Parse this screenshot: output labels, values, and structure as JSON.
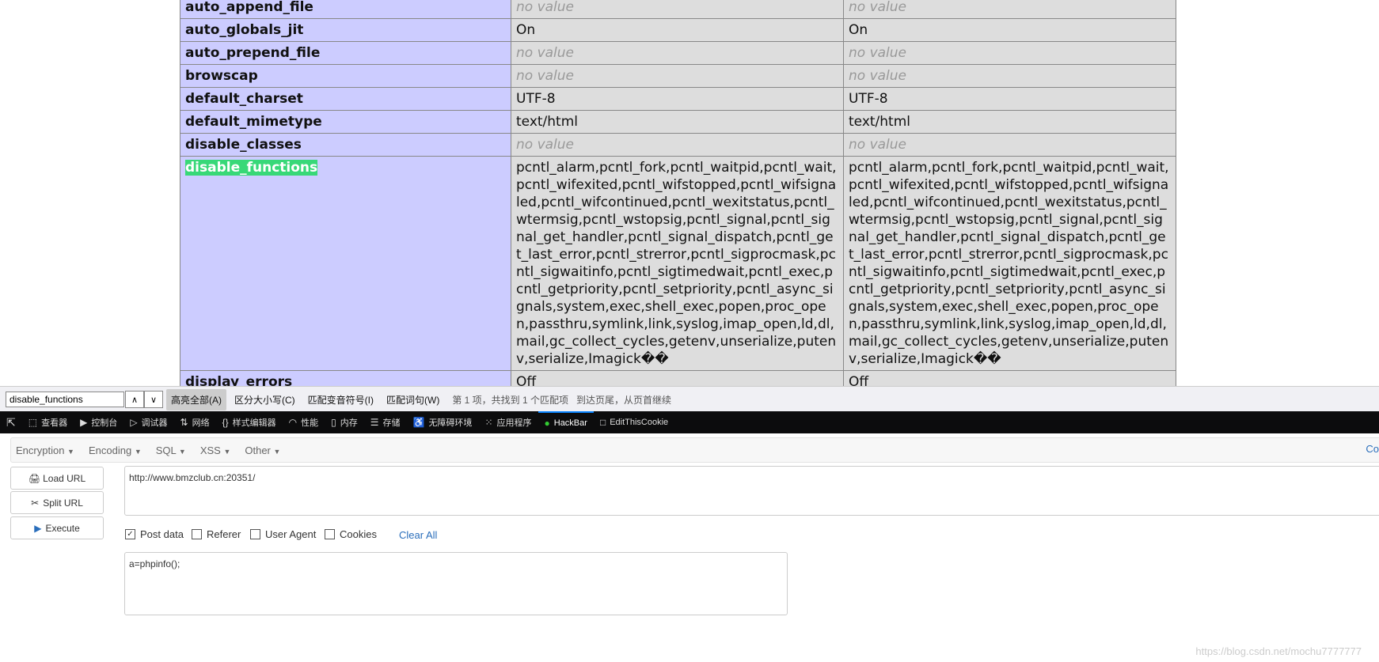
{
  "phpinfo": {
    "rows": [
      {
        "key": "auto_append_file",
        "local": "no value",
        "master": "no value",
        "nv": true
      },
      {
        "key": "auto_globals_jit",
        "local": "On",
        "master": "On"
      },
      {
        "key": "auto_prepend_file",
        "local": "no value",
        "master": "no value",
        "nv": true
      },
      {
        "key": "browscap",
        "local": "no value",
        "master": "no value",
        "nv": true
      },
      {
        "key": "default_charset",
        "local": "UTF-8",
        "master": "UTF-8"
      },
      {
        "key": "default_mimetype",
        "local": "text/html",
        "master": "text/html"
      },
      {
        "key": "disable_classes",
        "local": "no value",
        "master": "no value",
        "nv": true
      },
      {
        "key": "disable_functions",
        "local": "pcntl_alarm,pcntl_fork,pcntl_waitpid,pcntl_wait,pcntl_wifexited,pcntl_wifstopped,pcntl_wifsignaled,pcntl_wifcontinued,pcntl_wexitstatus,pcntl_wtermsig,pcntl_wstopsig,pcntl_signal,pcntl_signal_get_handler,pcntl_signal_dispatch,pcntl_get_last_error,pcntl_strerror,pcntl_sigprocmask,pcntl_sigwaitinfo,pcntl_sigtimedwait,pcntl_exec,pcntl_getpriority,pcntl_setpriority,pcntl_async_signals,system,exec,shell_exec,popen,proc_open,passthru,symlink,link,syslog,imap_open,ld,dl,mail,gc_collect_cycles,getenv,unserialize,putenv,serialize,Imagick��",
        "master": "pcntl_alarm,pcntl_fork,pcntl_waitpid,pcntl_wait,pcntl_wifexited,pcntl_wifstopped,pcntl_wifsignaled,pcntl_wifcontinued,pcntl_wexitstatus,pcntl_wtermsig,pcntl_wstopsig,pcntl_signal,pcntl_signal_get_handler,pcntl_signal_dispatch,pcntl_get_last_error,pcntl_strerror,pcntl_sigprocmask,pcntl_sigwaitinfo,pcntl_sigtimedwait,pcntl_exec,pcntl_getpriority,pcntl_setpriority,pcntl_async_signals,system,exec,shell_exec,popen,proc_open,passthru,symlink,link,syslog,imap_open,ld,dl,mail,gc_collect_cycles,getenv,unserialize,putenv,serialize,Imagick��",
        "highlight": true
      },
      {
        "key": "display_errors",
        "local": "Off",
        "master": "Off"
      }
    ]
  },
  "findbar": {
    "query": "disable_functions",
    "highlight_all": "高亮全部(A)",
    "match_case": "区分大小写(C)",
    "match_diacritics": "匹配变音符号(I)",
    "whole_words": "匹配词句(W)",
    "status": "第 1 项，共找到 1 个匹配项",
    "wrap": "到达页尾，从页首继续"
  },
  "devtools": {
    "tabs": [
      {
        "icon": "inspector-icon",
        "glyph": "⬚",
        "label": "查看器"
      },
      {
        "icon": "console-icon",
        "glyph": "▶",
        "label": "控制台"
      },
      {
        "icon": "debugger-icon",
        "glyph": "▷",
        "label": "调试器"
      },
      {
        "icon": "network-icon",
        "glyph": "⇅",
        "label": "网络"
      },
      {
        "icon": "style-editor-icon",
        "glyph": "{}",
        "label": "样式编辑器"
      },
      {
        "icon": "performance-icon",
        "glyph": "◠",
        "label": "性能"
      },
      {
        "icon": "memory-icon",
        "glyph": "▯",
        "label": "内存"
      },
      {
        "icon": "storage-icon",
        "glyph": "☰",
        "label": "存储"
      },
      {
        "icon": "accessibility-icon",
        "glyph": "♿",
        "label": "无障碍环境"
      },
      {
        "icon": "application-icon",
        "glyph": "⁙",
        "label": "应用程序"
      },
      {
        "icon": "hackbar-icon",
        "glyph": "●",
        "label": "HackBar",
        "active": true
      },
      {
        "icon": "editthiscookie-icon",
        "glyph": "□",
        "label": "EditThisCookie"
      }
    ]
  },
  "hackbar": {
    "menu": [
      "Encryption",
      "Encoding",
      "SQL",
      "XSS",
      "Other"
    ],
    "right_cut": "Co",
    "load_url": "Load URL",
    "split_url": "Split URL",
    "execute": "Execute",
    "url": "http://www.bmzclub.cn:20351/",
    "options": [
      {
        "label": "Post data",
        "checked": true
      },
      {
        "label": "Referer",
        "checked": false
      },
      {
        "label": "User Agent",
        "checked": false
      },
      {
        "label": "Cookies",
        "checked": false
      }
    ],
    "clear_all": "Clear All",
    "post_body": "a=phpinfo();"
  },
  "watermark": "https://blog.csdn.net/mochu7777777"
}
